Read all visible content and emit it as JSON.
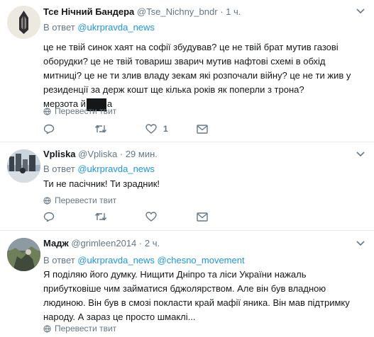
{
  "tweets": [
    {
      "name": "Тсе Нічний Бандера",
      "handle": "@Tse_Nichny_bndr",
      "time": "· 1 ч.",
      "reply_prefix": "В ответ",
      "reply_to": "@ukrpravda_news",
      "text": "це не твій синок хаят на софії збудував? це не твій брат мутив газові оборудки? це не твій товариш зварич мутив нафтові схемі в обхід митниці? це не ти злив владу зекам які розпочали війну? це не ти жив у резиденції за держ кошт ще кілька років як поперли з трона?",
      "text_tail_before": "мерзота й",
      "text_tail_after": "а",
      "translate": "Перевести твит",
      "likes": "1"
    },
    {
      "name": "Vpliska",
      "handle": "@Vpliska",
      "time": "· 29 мин.",
      "reply_prefix": "В ответ",
      "reply_to": "@ukrpravda_news",
      "text": "Ти не пасічник! Ти зрадник!",
      "translate": "Перевести твит"
    },
    {
      "name": "Мадж",
      "handle": "@grimleen2014",
      "time": "· 2 ч.",
      "reply_prefix": "В ответ",
      "reply_to": "@ukrpravda_news",
      "reply_to_2": "@chesno_movement",
      "text": "Я поділяю його думку. Нищити Дніпро та ліси України нажаль прибутковіше чим займатися бджолярством. Але він був владною людиною. Він був в смозі покласти край мафії яника. Він мав підтримку народу. А зараз це просто шмаклі...",
      "translate": "Перевести твит"
    }
  ]
}
